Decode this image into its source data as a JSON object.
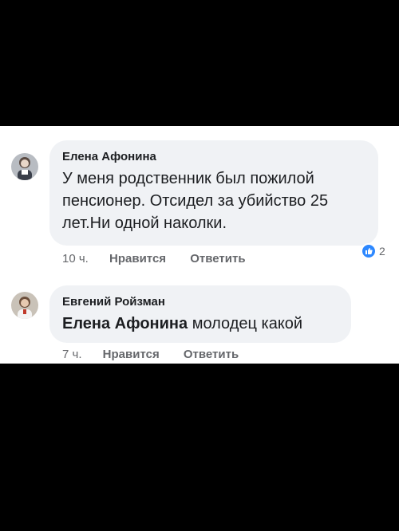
{
  "comments": [
    {
      "author": "Елена Афонина",
      "text": "У меня родственник был пожилой пенсионер. Отсидел за убийство 25 лет.Ни одной наколки.",
      "time": "10 ч.",
      "like_label": "Нравится",
      "reply_label": "Ответить",
      "reaction_count": "2",
      "reaction_icon": "like-icon",
      "avatar_icon": "user-avatar"
    },
    {
      "author": "Евгений Ройзман",
      "mention": "Елена Афонина",
      "text": " молодец какой",
      "time": "7 ч.",
      "like_label": "Нравится",
      "reply_label": "Ответить",
      "avatar_icon": "user-avatar"
    }
  ],
  "colors": {
    "background": "#000000",
    "card": "#ffffff",
    "bubble": "#f0f2f5",
    "text": "#1c1e21",
    "meta": "#65676b",
    "reaction": "#2d88ff"
  }
}
